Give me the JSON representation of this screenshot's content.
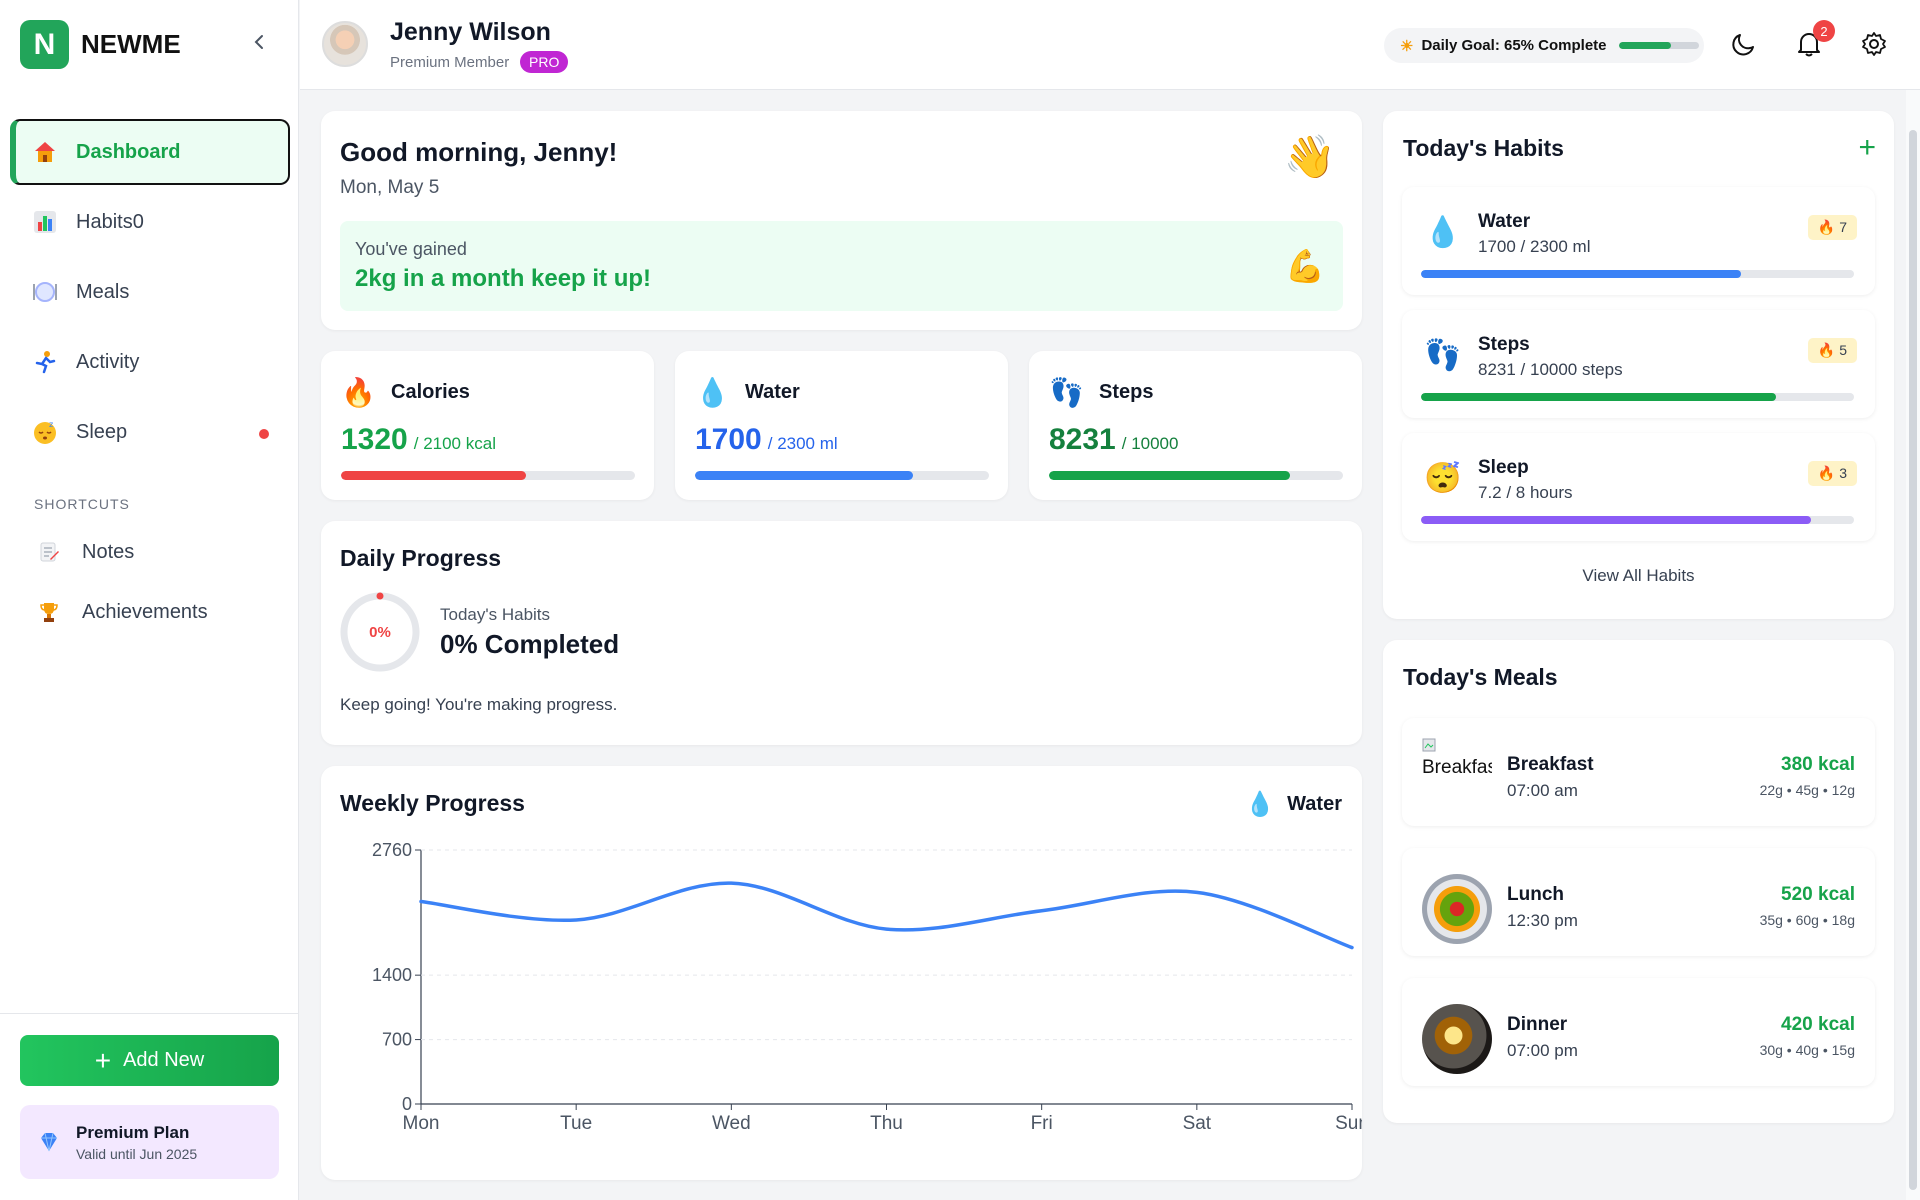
{
  "brand": {
    "letter": "N",
    "name": "NEWME",
    "accent": "#22a55a"
  },
  "nav": [
    {
      "label": "Dashboard",
      "icon": "house-icon",
      "active": true
    },
    {
      "label": "Habits0",
      "icon": "bar-chart-icon"
    },
    {
      "label": "Meals",
      "icon": "plate-icon"
    },
    {
      "label": "Activity",
      "icon": "runner-icon"
    },
    {
      "label": "Sleep",
      "icon": "sleeping-face-icon",
      "dot": true
    }
  ],
  "shortcuts": {
    "heading": "SHORTCUTS",
    "items": [
      {
        "label": "Notes",
        "icon": "note-icon"
      },
      {
        "label": "Achievements",
        "icon": "trophy-icon"
      }
    ]
  },
  "add_new": {
    "label": "Add New"
  },
  "plan": {
    "title": "Premium Plan",
    "subtitle": "Valid until Jun 2025"
  },
  "header": {
    "user_name": "Jenny Wilson",
    "user_role": "Premium Member",
    "badge": "PRO",
    "goal_text": "Daily Goal: 65% Complete",
    "goal_progress": 0.65,
    "notifications": "2"
  },
  "greeting": {
    "title": "Good morning, Jenny!",
    "date": "Mon, May 5",
    "gain_line1": "You've gained",
    "gain_line2": "2kg in a month keep it up!"
  },
  "stats": [
    {
      "name": "Calories",
      "value": "1320",
      "unit": "/ 2100 kcal",
      "progress": 0.63,
      "color": "#ef4444",
      "text_color": "#16a34a",
      "icon": "fire-icon"
    },
    {
      "name": "Water",
      "value": "1700",
      "unit": "/ 2300 ml",
      "progress": 0.74,
      "color": "#3b82f6",
      "text_color": "#2563eb",
      "icon": "droplet-icon"
    },
    {
      "name": "Steps",
      "value": "8231",
      "unit": "/ 10000",
      "progress": 0.82,
      "color": "#16a34a",
      "text_color": "#15803d",
      "icon": "footprints-icon"
    }
  ],
  "daily": {
    "title": "Daily Progress",
    "ring_label": "0%",
    "sub": "Today's Habits",
    "completed": "0% Completed",
    "message": "Keep going! You're making progress."
  },
  "weekly": {
    "title": "Weekly Progress",
    "selector": "Water"
  },
  "chart_data": {
    "type": "line",
    "title": "Weekly Progress",
    "series": [
      {
        "name": "Water",
        "values": [
          2200,
          2000,
          2400,
          1900,
          2100,
          2300,
          1700
        ]
      }
    ],
    "categories": [
      "Mon",
      "Tue",
      "Wed",
      "Thu",
      "Fri",
      "Sat",
      "Sun"
    ],
    "yticks": [
      0,
      700,
      1400,
      2760
    ],
    "ylim": [
      0,
      2760
    ],
    "grid": true,
    "color": "#3b82f6"
  },
  "habits": {
    "title": "Today's Habits",
    "add": "+",
    "items": [
      {
        "name": "Water",
        "value": "1700 / 2300 ml",
        "streak": "7",
        "progress": 0.74,
        "color": "#3b82f6",
        "icon": "droplet-icon"
      },
      {
        "name": "Steps",
        "value": "8231 / 10000 steps",
        "streak": "5",
        "progress": 0.82,
        "color": "#16a34a",
        "icon": "footprints-icon"
      },
      {
        "name": "Sleep",
        "value": "7.2 / 8 hours",
        "streak": "3",
        "progress": 0.9,
        "color": "#8b5cf6",
        "icon": "sleeping-face-icon"
      }
    ],
    "view_all": "View All Habits"
  },
  "meals": {
    "title": "Today's Meals",
    "items": [
      {
        "name": "Breakfast",
        "time": "07:00 am",
        "kcal": "380 kcal",
        "macros": "22g • 45g • 12g",
        "image_alt": "Breakfast"
      },
      {
        "name": "Lunch",
        "time": "12:30 pm",
        "kcal": "520 kcal",
        "macros": "35g • 60g • 18g"
      },
      {
        "name": "Dinner",
        "time": "07:00 pm",
        "kcal": "420 kcal",
        "macros": "30g • 40g • 15g"
      }
    ]
  }
}
